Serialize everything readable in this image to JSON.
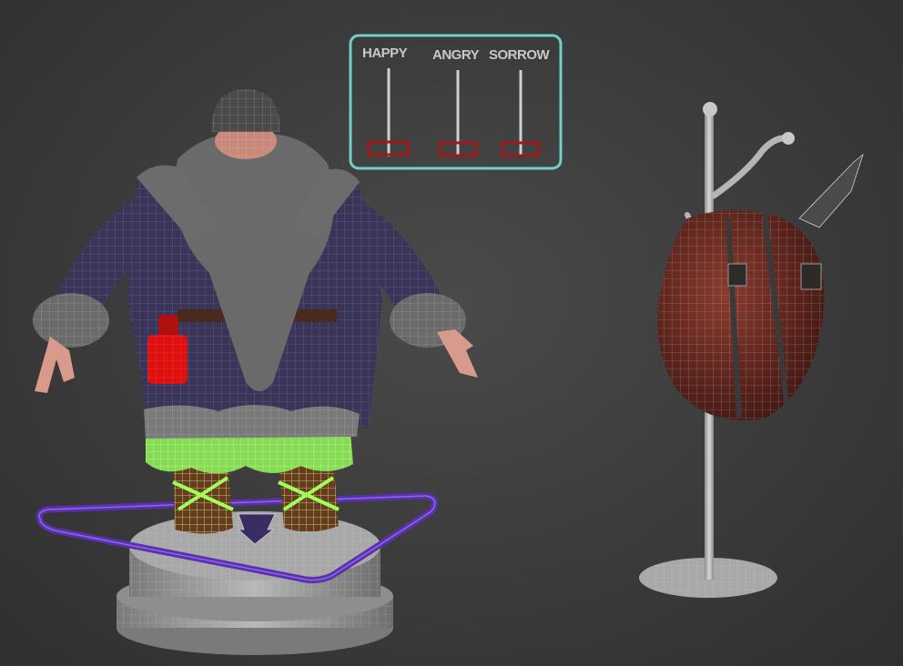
{
  "viewport": {
    "name": "Perspective viewport",
    "background_color": "#3c3c3c"
  },
  "expression_panel": {
    "border_color": "#6fd0c8",
    "slider_handle_color": "#a01818",
    "sliders": [
      {
        "label": "HAPPY"
      },
      {
        "label": "ANGRY"
      },
      {
        "label": "SORROW"
      }
    ]
  },
  "objects": {
    "character": {
      "name": "dwarf-character",
      "coat_color": "#3a3458",
      "beard_color": "#6a6a6a",
      "selected_part_color": "#8be35a"
    },
    "pedestal": {
      "name": "turntable-pedestal",
      "color": "#9a9a9a"
    },
    "control_shape": {
      "name": "triangle-ground-control",
      "color": "#5a2fb0"
    },
    "stand": {
      "name": "coat-stand",
      "color": "#b5b5b5"
    },
    "backpack": {
      "name": "backpack",
      "color": "#6a2b22"
    },
    "lantern": {
      "name": "red-lantern",
      "color": "#e01010"
    }
  }
}
